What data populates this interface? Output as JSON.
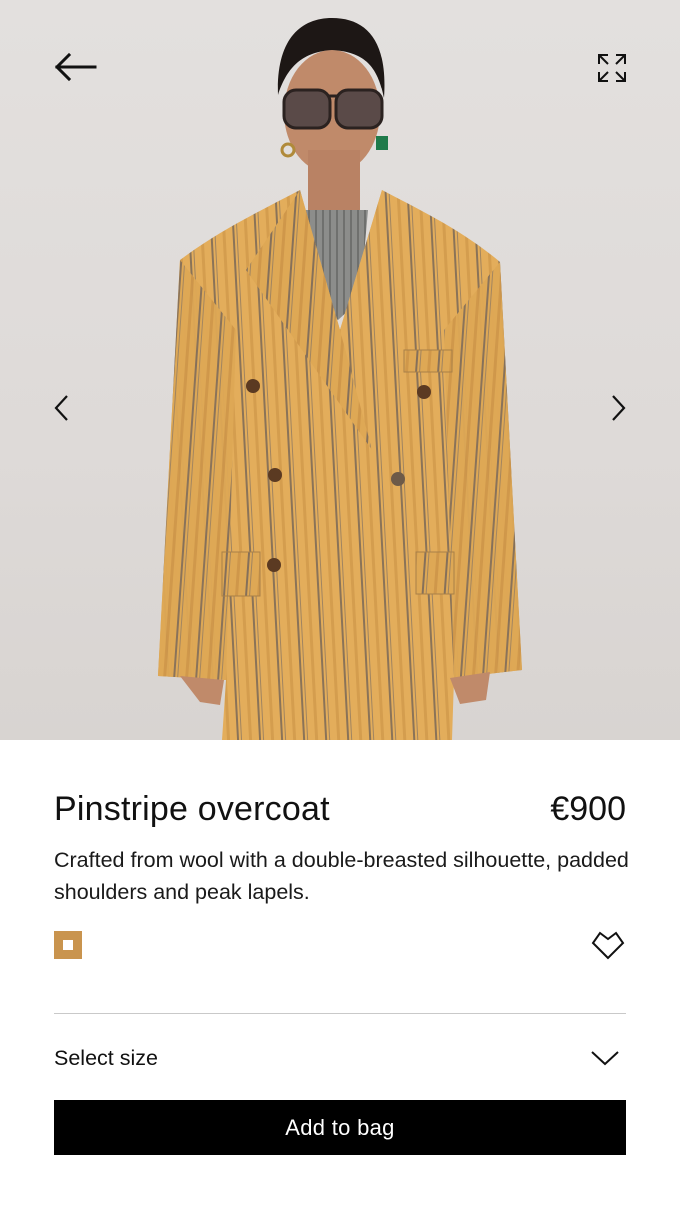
{
  "hero": {
    "back_icon": "arrow-left-icon",
    "expand_icon": "expand-icon",
    "prev_icon": "chevron-left-icon",
    "next_icon": "chevron-right-icon",
    "image_subject": "model-wearing-pinstripe-overcoat"
  },
  "product": {
    "name": "Pinstripe overcoat",
    "price": "€900",
    "description": "Crafted from wool with a double-breasted silhouette, padded shoulders and peak lapels.",
    "color_swatch": "#c9944e",
    "wishlist_icon": "heart-icon"
  },
  "size": {
    "label": "Select size",
    "icon": "chevron-down-icon"
  },
  "cta": {
    "add_to_bag": "Add to bag"
  },
  "colors": {
    "coat": "#e6b25f",
    "stripe": "#7a6a54",
    "background": "#dedad8",
    "button": "#000000"
  }
}
